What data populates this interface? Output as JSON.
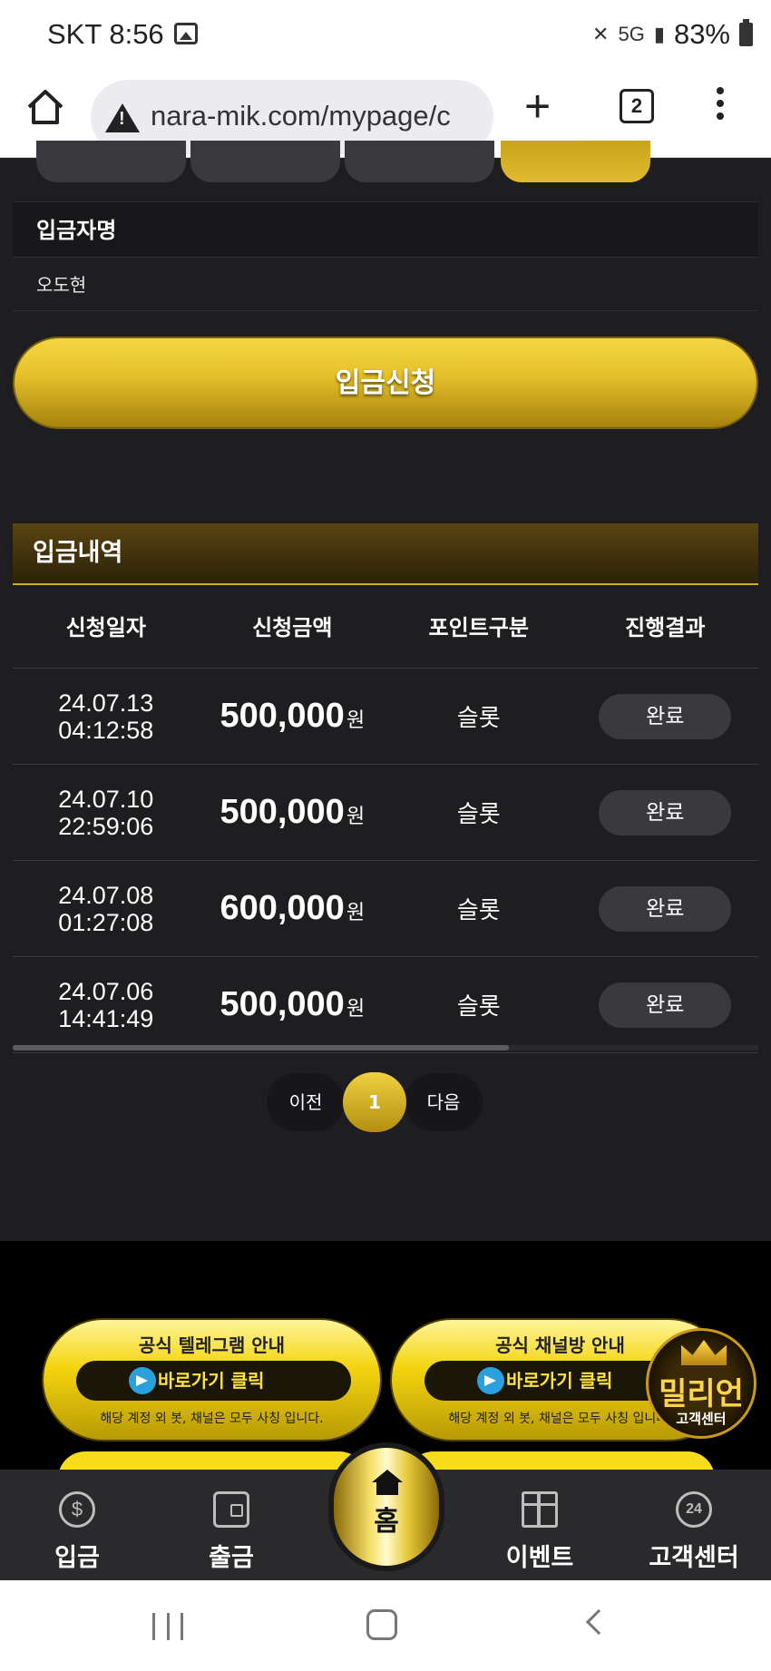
{
  "status_bar": {
    "carrier_time": "SKT 8:56",
    "network": "5G",
    "battery": "83%"
  },
  "browser": {
    "url": "nara-mik.com/mypage/c",
    "tab_count": "2"
  },
  "deposit_form": {
    "depositor_label": "입금자명",
    "depositor_value": "오도현",
    "submit_label": "입금신청"
  },
  "history": {
    "title": "입금내역",
    "columns": [
      "신청일자",
      "신청금액",
      "포인트구분",
      "진행결과"
    ],
    "rows": [
      {
        "date": "24.07.13",
        "time": "04:12:58",
        "amount": "500,000",
        "unit": "원",
        "point_type": "슬롯",
        "status": "완료"
      },
      {
        "date": "24.07.10",
        "time": "22:59:06",
        "amount": "500,000",
        "unit": "원",
        "point_type": "슬롯",
        "status": "완료"
      },
      {
        "date": "24.07.08",
        "time": "01:27:08",
        "amount": "600,000",
        "unit": "원",
        "point_type": "슬롯",
        "status": "완료"
      },
      {
        "date": "24.07.06",
        "time": "14:41:49",
        "amount": "500,000",
        "unit": "원",
        "point_type": "슬롯",
        "status": "완료"
      }
    ]
  },
  "pagination": {
    "prev": "이전",
    "current": "1",
    "next": "다음"
  },
  "promos": [
    {
      "title": "공식 텔레그램 안내",
      "button": "바로가기 클릭",
      "note": "해당 계정 외 봇, 채널은 모두 사칭 입니다."
    },
    {
      "title": "공식 채널방 안내",
      "button": "바로가기 클릭",
      "note": "해당 계정 외 봇, 채널은 모두 사칭 입니다."
    }
  ],
  "support_badge": {
    "big": "밀리언",
    "small": "고객센터"
  },
  "bottom_nav": {
    "deposit": "입금",
    "withdraw": "출금",
    "home": "홈",
    "event": "이벤트",
    "support": "고객센터",
    "coin_glyph": "$",
    "h24_glyph": "24"
  }
}
